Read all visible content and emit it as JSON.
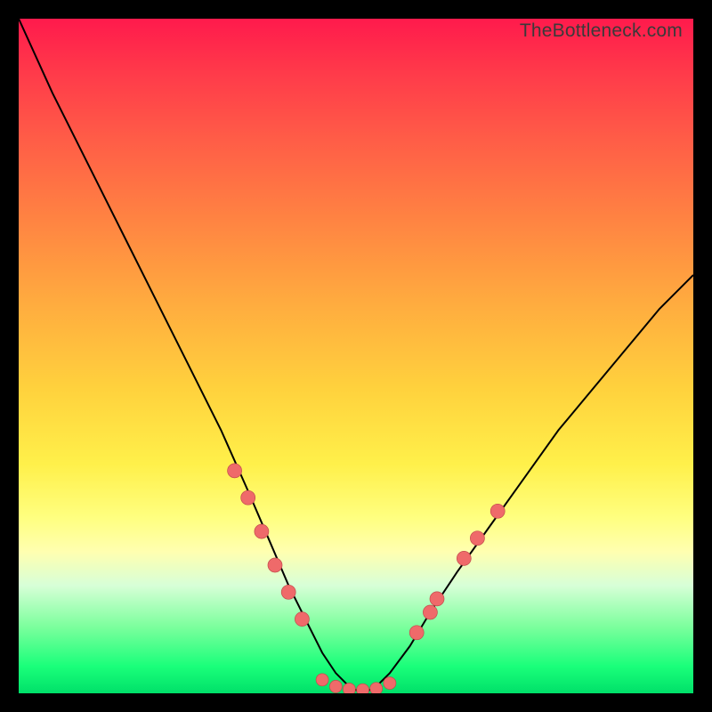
{
  "watermark": "TheBottleneck.com",
  "chart_data": {
    "type": "line",
    "title": "",
    "subtitle": "",
    "xlabel": "",
    "ylabel": "",
    "xlim": [
      0,
      100
    ],
    "ylim": [
      0,
      100
    ],
    "grid": false,
    "legend": false,
    "background_gradient": [
      "#ff1a4c",
      "#ff8442",
      "#ffd23d",
      "#ffffb0",
      "#00e069"
    ],
    "series": [
      {
        "name": "bottleneck-curve",
        "x": [
          0,
          5,
          10,
          15,
          20,
          25,
          30,
          34,
          37,
          40,
          43,
          45,
          47,
          49,
          51,
          53,
          55,
          58,
          61,
          65,
          70,
          75,
          80,
          85,
          90,
          95,
          100
        ],
        "values": [
          100,
          89,
          79,
          69,
          59,
          49,
          39,
          30,
          23,
          16,
          10,
          6,
          3,
          1,
          0,
          1,
          3,
          7,
          12,
          18,
          25,
          32,
          39,
          45,
          51,
          57,
          62
        ]
      }
    ],
    "markers": {
      "left_branch": [
        {
          "x": 32,
          "y": 33
        },
        {
          "x": 34,
          "y": 29
        },
        {
          "x": 36,
          "y": 24
        },
        {
          "x": 38,
          "y": 19
        },
        {
          "x": 40,
          "y": 15
        },
        {
          "x": 42,
          "y": 11
        }
      ],
      "right_branch": [
        {
          "x": 59,
          "y": 9
        },
        {
          "x": 61,
          "y": 12
        },
        {
          "x": 62,
          "y": 14
        },
        {
          "x": 66,
          "y": 20
        },
        {
          "x": 68,
          "y": 23
        },
        {
          "x": 71,
          "y": 27
        }
      ],
      "flat_cluster": [
        {
          "x": 45,
          "y": 2
        },
        {
          "x": 47,
          "y": 1
        },
        {
          "x": 49,
          "y": 0.6
        },
        {
          "x": 51,
          "y": 0.5
        },
        {
          "x": 53,
          "y": 0.7
        },
        {
          "x": 55,
          "y": 1.5
        }
      ]
    }
  }
}
